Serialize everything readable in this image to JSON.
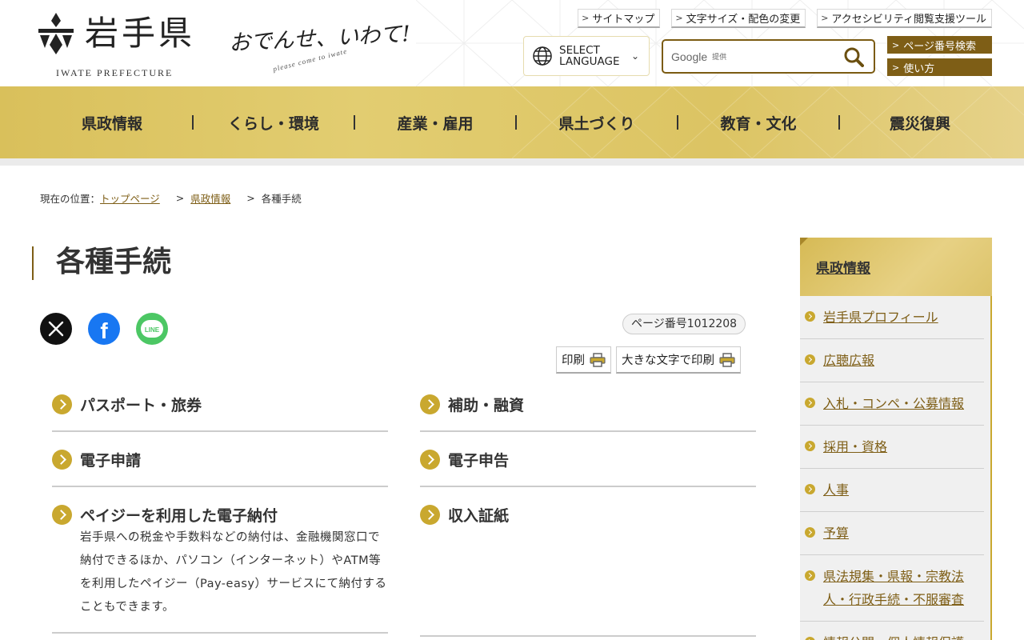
{
  "header": {
    "logo_jp": "岩手県",
    "logo_en": "IWATE PREFECTURE",
    "slogan": "おでんせ、いわて!",
    "slogan_sub": "please come to iwate",
    "util_links": [
      "サイトマップ",
      "文字サイズ・配色の変更",
      "アクセシビリティ閲覧支援ツール"
    ],
    "language_label_1": "SELECT",
    "language_label_2": "LANGUAGE",
    "search_provider": "Google",
    "search_provider_suffix": "提供",
    "page_number_search": "ページ番号検索",
    "usage": "使い方"
  },
  "nav": {
    "items": [
      "県政情報",
      "くらし・環境",
      "産業・雇用",
      "県土づくり",
      "教育・文化",
      "震災復興"
    ]
  },
  "breadcrumb": {
    "prefix": "現在の位置：",
    "links": [
      "トップページ",
      "県政情報"
    ],
    "current": "各種手続"
  },
  "page": {
    "title": "各種手続",
    "page_number": "ページ番号1012208",
    "print": "印刷",
    "print_large": "大きな文字で印刷"
  },
  "share": {
    "x": "X",
    "facebook": "f",
    "line": "LINE"
  },
  "items": [
    {
      "title": "パスポート・旅券"
    },
    {
      "title": "補助・融資"
    },
    {
      "title": "電子申請"
    },
    {
      "title": "電子申告"
    },
    {
      "title": "ペイジーを利用した電子納付",
      "desc": "岩手県への税金や手数料などの納付は、金融機関窓口で納付できるほか、パソコン（インターネット）やATM等を利用したペイジー（Pay-easy）サービスにて納付することもできます。"
    },
    {
      "title": "収入証紙"
    }
  ],
  "sidebar": {
    "title": "県政情報",
    "items": [
      "岩手県プロフィール",
      "広聴広報",
      "入札・コンペ・公募情報",
      "採用・資格",
      "人事",
      "予算",
      "県法規集・県報・宗教法人・行政手続・不服審査",
      "情報公開・個人情報保護"
    ]
  },
  "colors": {
    "gold": "#c9a82f",
    "brown": "#7e5e16",
    "nav_bg": "#dcc463"
  }
}
